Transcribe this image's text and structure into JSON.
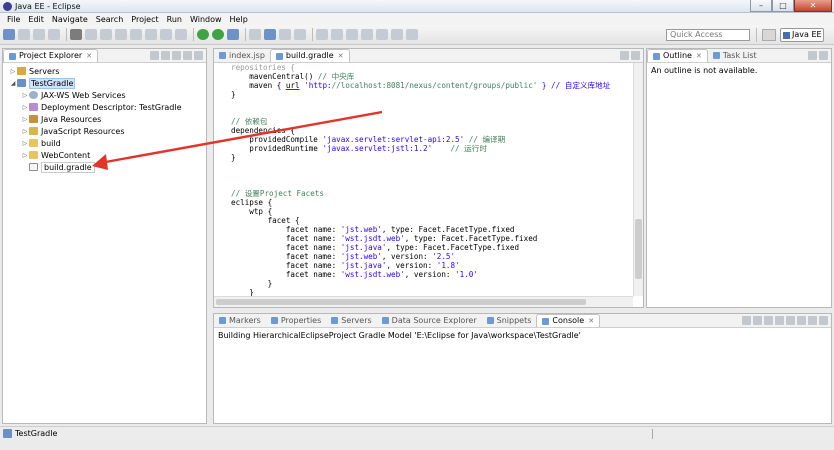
{
  "window": {
    "title": "Java EE - Eclipse",
    "minimize": "–",
    "maximize": "□",
    "close": "✕"
  },
  "menu": [
    "File",
    "Edit",
    "Navigate",
    "Search",
    "Project",
    "Run",
    "Window",
    "Help"
  ],
  "toolbar": {
    "quick_access_placeholder": "Quick Access",
    "perspective": "Java EE"
  },
  "explorer": {
    "tab_label": "Project Explorer",
    "tree": [
      {
        "label": "Servers",
        "icon": "server-icon",
        "twisty": "▷",
        "indent": 0
      },
      {
        "label": "TestGradle",
        "icon": "project-icon",
        "twisty": "◢",
        "indent": 0,
        "selected": true
      },
      {
        "label": "JAX-WS Web Services",
        "icon": "web-services-icon",
        "twisty": "▷",
        "indent": 1
      },
      {
        "label": "Deployment Descriptor: TestGradle",
        "icon": "deployment-descriptor-icon",
        "twisty": "▷",
        "indent": 1
      },
      {
        "label": "Java Resources",
        "icon": "java-resources-icon",
        "twisty": "▷",
        "indent": 1
      },
      {
        "label": "JavaScript Resources",
        "icon": "javascript-resources-icon",
        "twisty": "▷",
        "indent": 1
      },
      {
        "label": "build",
        "icon": "folder-icon",
        "twisty": "▷",
        "indent": 1
      },
      {
        "label": "WebContent",
        "icon": "folder-icon",
        "twisty": "▷",
        "indent": 1
      },
      {
        "label": "build.gradle",
        "icon": "file-icon",
        "twisty": "",
        "indent": 1,
        "boxed": true
      }
    ]
  },
  "editor": {
    "tabs": [
      {
        "label": "index.jsp",
        "active": false
      },
      {
        "label": "build.gradle",
        "active": true
      }
    ],
    "lines": [
      "repositories {",
      "    mavenCentral() // 中央库",
      "    maven { url 'http://localhost:8081/nexus/content/groups/public' } // 自定义库地址",
      "}",
      "",
      "",
      "// 依赖包",
      "dependencies {",
      "    providedCompile 'javax.servlet:servlet-api:2.5' // 编译期",
      "    providedRuntime 'javax.servlet:jstl:1.2'    // 运行时",
      "}",
      "",
      "",
      "",
      "// 设置Project Facets",
      "eclipse {",
      "    wtp {",
      "        facet {",
      "            facet name: 'jst.web', type: Facet.FacetType.fixed",
      "            facet name: 'wst.jsdt.web', type: Facet.FacetType.fixed",
      "            facet name: 'jst.java', type: Facet.FacetType.fixed",
      "            facet name: 'jst.web', version: '2.5'",
      "            facet name: 'jst.java', version: '1.8'",
      "            facet name: 'wst.jsdt.web', version: '1.0'",
      "        }",
      "    }",
      "}"
    ]
  },
  "outline": {
    "tabs": [
      {
        "label": "Outline",
        "active": true
      },
      {
        "label": "Task List",
        "active": false
      }
    ],
    "message": "An outline is not available."
  },
  "console": {
    "tabs": [
      {
        "label": "Markers",
        "active": false
      },
      {
        "label": "Properties",
        "active": false
      },
      {
        "label": "Servers",
        "active": false
      },
      {
        "label": "Data Source Explorer",
        "active": false
      },
      {
        "label": "Snippets",
        "active": false
      },
      {
        "label": "Console",
        "active": true
      }
    ],
    "message": "Building HierarchicalEclipseProject Gradle Model 'E:\\Eclipse for Java\\workspace\\TestGradle'"
  },
  "status": {
    "text": "TestGradle"
  },
  "annotation": {
    "arrow_color": "#e0352b"
  }
}
